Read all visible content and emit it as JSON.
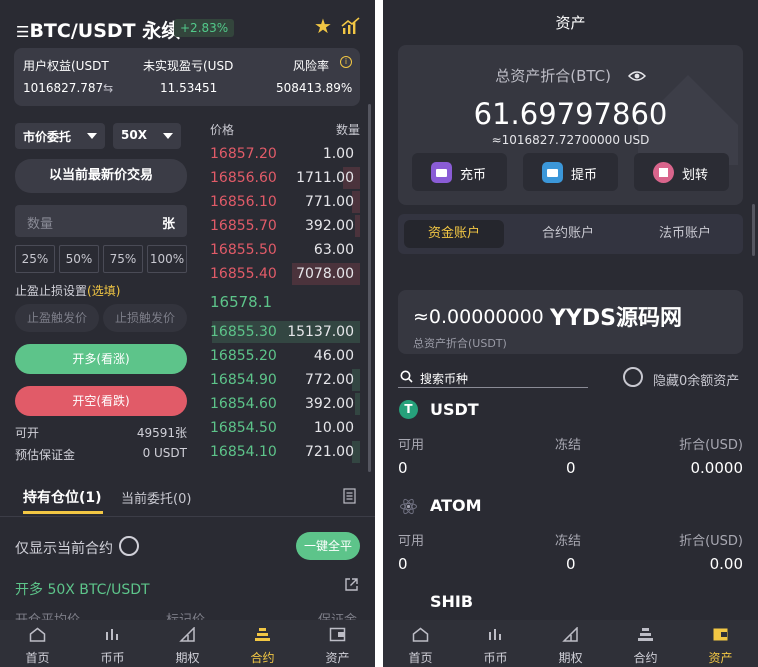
{
  "left": {
    "header": {
      "title": "BTC/USDT 永续",
      "change": "+2.83%"
    },
    "equity": {
      "labels": [
        "用户权益(USDT",
        "未实现盈亏(USD",
        "风险率"
      ],
      "values": [
        "1016827.787",
        "11.53451",
        "508413.89%"
      ]
    },
    "order_form": {
      "order_type": "市价委托",
      "leverage": "50X",
      "price_mode_button": "以当前最新价交易",
      "quantity_placeholder": "数量",
      "quantity_unit": "张",
      "percent_options": [
        "25%",
        "50%",
        "75%",
        "100%"
      ],
      "tpsl_label": "止盈止损设置",
      "tpsl_optional": "(选填)",
      "tp_placeholder": "止盈触发价",
      "sl_placeholder": "止损触发价",
      "long_button": "开多(看涨)",
      "short_button": "开空(看跌)",
      "available_label": "可开",
      "available_value": "49591张",
      "margin_label": "预估保证金",
      "margin_value": "0 USDT"
    },
    "orderbook": {
      "price_header": "价格",
      "qty_header": "数量",
      "asks": [
        {
          "price": "16857.20",
          "qty": "1.00",
          "depth": 0.0
        },
        {
          "price": "16856.60",
          "qty": "1711.00",
          "depth": 0.11
        },
        {
          "price": "16856.10",
          "qty": "771.00",
          "depth": 0.05
        },
        {
          "price": "16855.70",
          "qty": "392.00",
          "depth": 0.03
        },
        {
          "price": "16855.50",
          "qty": "63.00",
          "depth": 0.0
        },
        {
          "price": "16855.40",
          "qty": "7078.00",
          "depth": 0.44
        }
      ],
      "last_price": "16578.1",
      "bids": [
        {
          "price": "16855.30",
          "qty": "15137.00",
          "depth": 0.96
        },
        {
          "price": "16855.20",
          "qty": "46.00",
          "depth": 0.0
        },
        {
          "price": "16854.90",
          "qty": "772.00",
          "depth": 0.05
        },
        {
          "price": "16854.60",
          "qty": "392.00",
          "depth": 0.03
        },
        {
          "price": "16854.50",
          "qty": "10.00",
          "depth": 0.0
        },
        {
          "price": "16854.10",
          "qty": "721.00",
          "depth": 0.05
        }
      ]
    },
    "positions": {
      "tab_active": "持有仓位(1)",
      "tab_other": "当前委托(0)",
      "filter_label": "仅显示当前合约",
      "close_all_button": "一键全平",
      "position_title": "开多 50X BTC/USDT",
      "columns": [
        "开仓平均价",
        "标记价",
        "保证金"
      ]
    },
    "nav": {
      "items": [
        "首页",
        "币币",
        "期权",
        "合约",
        "资产"
      ],
      "active_index": 3
    }
  },
  "right": {
    "title": "资产",
    "total_label": "总资产折合(BTC)",
    "total_btc": "61.69797860",
    "total_usd": "≈1016827.72700000 USD",
    "actions": [
      "充币",
      "提币",
      "划转"
    ],
    "account_tabs": [
      "资金账户",
      "合约账户",
      "法币账户"
    ],
    "account_active_index": 0,
    "balance": {
      "value": "≈0.00000000",
      "label": "总资产折合(USDT)",
      "watermark": "YYDS源码网"
    },
    "search_placeholder": "搜索币种",
    "hide_zero_label": "隐藏0余额资产",
    "column_labels": [
      "可用",
      "冻结",
      "折合(USD)"
    ],
    "coins": [
      {
        "name": "USDT",
        "available": "0",
        "frozen": "0",
        "usd": "0.0000"
      },
      {
        "name": "ATOM",
        "available": "0",
        "frozen": "0",
        "usd": "0.00"
      },
      {
        "name": "SHIB",
        "available": "",
        "frozen": "",
        "usd": ""
      }
    ],
    "nav": {
      "items": [
        "首页",
        "币币",
        "期权",
        "合约",
        "资产"
      ],
      "active_index": 4
    }
  },
  "colors": {
    "ask": "#e15b68",
    "bid": "#5dc48a",
    "accent": "#f2c744",
    "background": "#2a2b33"
  }
}
